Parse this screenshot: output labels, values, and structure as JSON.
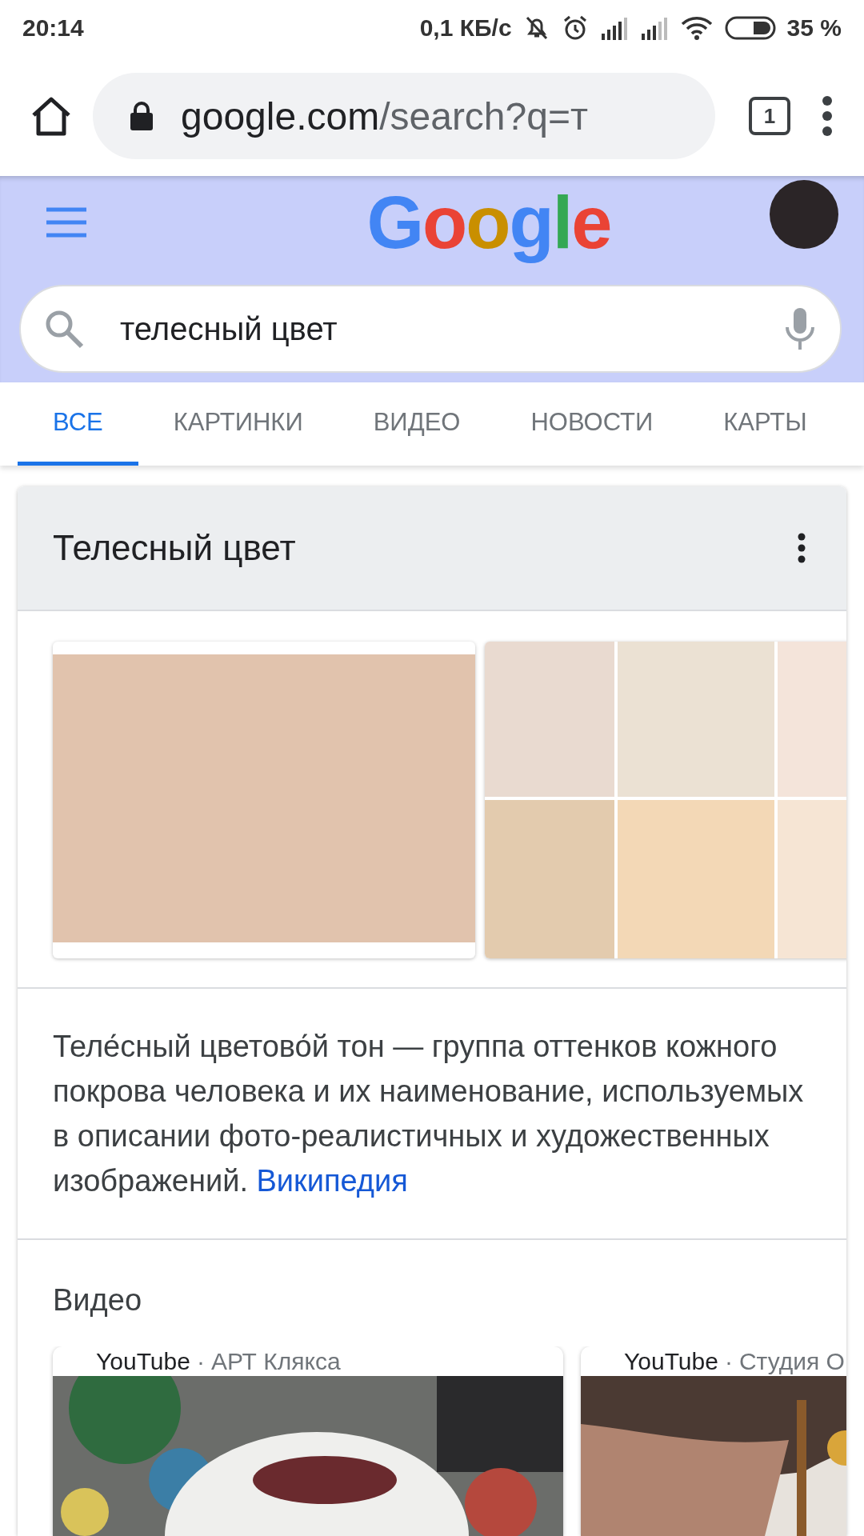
{
  "status_bar": {
    "time": "20:14",
    "speed": "0,1 КБ/с",
    "battery": "35 %"
  },
  "browser": {
    "host": "google.com",
    "path": "/search?q=т",
    "tab_count": "1"
  },
  "header": {
    "logo": "Google",
    "query": "телесный цвет"
  },
  "tabs": [
    {
      "label": "ВСЕ",
      "selected": true
    },
    {
      "label": "КАРТИНКИ",
      "selected": false
    },
    {
      "label": "ВИДЕО",
      "selected": false
    },
    {
      "label": "НОВОСТИ",
      "selected": false
    },
    {
      "label": "КАРТЫ",
      "selected": false
    }
  ],
  "card": {
    "title": "Телесный цвет",
    "swatches": [
      {
        "kind": "single",
        "color": "#e1c3ad"
      },
      {
        "kind": "grid",
        "tiles": [
          {
            "color": "#e9dad0"
          },
          {
            "color": "#ebe1d3"
          },
          {
            "color": "#f4e4da"
          },
          {
            "color": "#e3cbae"
          },
          {
            "color": "#f3d8b6"
          },
          {
            "color": "#f6e5d4"
          }
        ]
      }
    ],
    "description": "Теле́сный цветово́й тон — группа оттенков кожного покрова человека и их наименование, используемых в описании фото-реалистичных и художественных изображений.",
    "source_link": "Википедия",
    "videos_heading": "Видео",
    "videos": [
      {
        "source": "YouTube",
        "separator": "·",
        "channel": "АРТ Клякса",
        "kind": "picture"
      },
      {
        "source": "YouTube",
        "separator": "·",
        "channel": "Студия О",
        "kind": "picture"
      }
    ]
  }
}
